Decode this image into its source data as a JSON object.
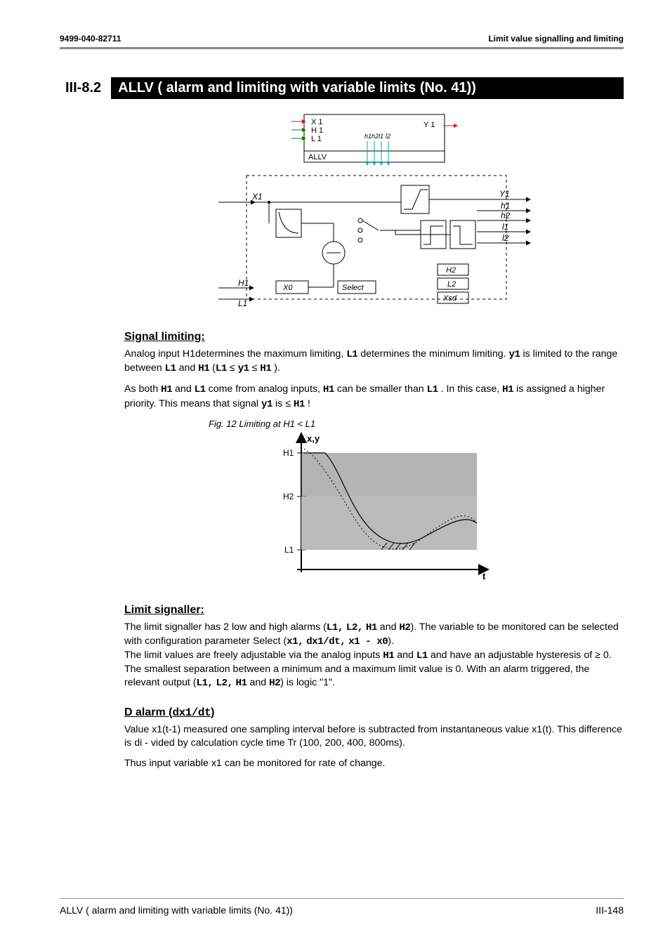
{
  "header": {
    "left": "9499-040-82711",
    "right": "Limit value signalling and limiting"
  },
  "section": {
    "number": "III-8.2",
    "title": "ALLV ( alarm and limiting with variable limits (No. 41))"
  },
  "diagram": {
    "block_label": "ALLV",
    "inputs_top": [
      "X 1",
      "H 1",
      "L 1"
    ],
    "output_top": "Y 1",
    "alarms": [
      "h1",
      "h2",
      "l1",
      "l2"
    ],
    "labels": {
      "X1": "X1",
      "H1": "H1",
      "L1": "L1",
      "X0": "X0",
      "Select": "Select",
      "H2": "H2",
      "L2": "L2",
      "Xsd": "Xsd",
      "Y1": "Y1",
      "h1": "h1",
      "h2": "h2",
      "l1": "l1",
      "l2": "l2"
    }
  },
  "signal_limiting": {
    "heading": "Signal limiting:",
    "p1_a": "Analog input H1determines the maximum limiting, ",
    "p1_b": " determines the minimum limiting. ",
    "p1_c": " is limited to the range between ",
    "p1_d": " and ",
    "p1_e": " (",
    "p1_f": " ≤ ",
    "p1_g": " ≤ ",
    "p1_h": " ).",
    "L1": "L1",
    "y1": "y1",
    "H1": "H1",
    "p2_a": "As both ",
    "p2_b": " and ",
    "p2_c": " come from analog inputs, ",
    "p2_d": " can be smaller than ",
    "p2_e": " . In this case, ",
    "p2_f": " is assigned a higher priority. This means that signal ",
    "p2_g": " is ≤ ",
    "p2_h": " !"
  },
  "fig12": {
    "caption": "Fig. 12   Limiting at H1 < L1",
    "axis_xy": "x,y",
    "H1": "H1",
    "H2": "H2",
    "L1": "L1",
    "t": "t"
  },
  "limit_signaller": {
    "heading": "Limit signaller:",
    "p1_a": "The limit signaller has 2 low and high alarms (",
    "L1c": "L1,",
    "L2c": "L2,",
    "H1": "H1",
    "and": " and ",
    "H2": "H2",
    "p1_b": "). The variable to be monitored can be selected with configuration parameter Select (",
    "x1c": "x1,",
    "dx1dtc": "dx1/dt,",
    "x1mx0": "x1 - x0",
    "p1_c": ").",
    "p2_a": "The limit values are freely adjustable via the analog inputs ",
    "p2_b": " and have an adjustable hysteresis of ≥  0. The smallest separation between a minimum and a maximum limit value is 0. With an alarm triggered, the relevant output (",
    "p2_c": ") is logic \"1\"."
  },
  "d_alarm": {
    "heading_a": "D alarm (",
    "heading_mono": "dx1/dt",
    "heading_b": ")",
    "p1": "Value x1(t-1) measured one sampling interval before is subtracted from instantaneous value x1(t). This difference is di - vided by calculation cycle time Tr (100, 200, 400, 800ms).",
    "p2": "Thus input variable x1 can be monitored for rate of change."
  },
  "footer": {
    "left": "ALLV ( alarm and limiting with variable limits (No. 41))",
    "right": "III-148"
  }
}
